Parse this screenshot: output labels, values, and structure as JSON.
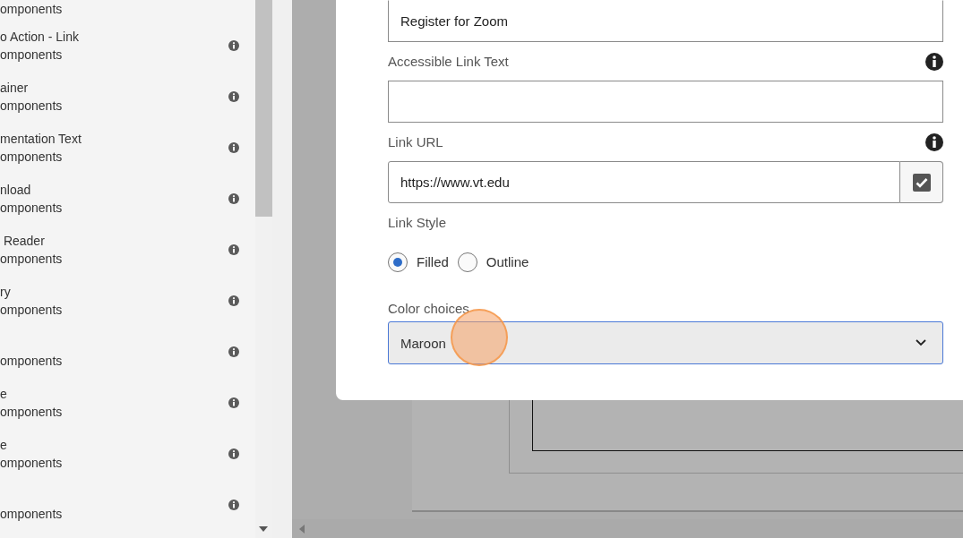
{
  "sidebar": {
    "items": [
      {
        "subtitle": "omponents"
      },
      {
        "title": "o Action - Link",
        "subtitle": "omponents"
      },
      {
        "title": "ainer",
        "subtitle": "omponents"
      },
      {
        "title": "mentation Text",
        "subtitle": "omponents"
      },
      {
        "title": "nload",
        "subtitle": "omponents"
      },
      {
        "title": " Reader",
        "subtitle": "omponents"
      },
      {
        "title": "ry",
        "subtitle": "omponents"
      },
      {
        "subtitle": "omponents"
      },
      {
        "title": "e",
        "subtitle": "omponents"
      },
      {
        "title": "e",
        "subtitle": "omponents"
      },
      {
        "subtitle": "omponents"
      }
    ]
  },
  "dialog": {
    "text_field": {
      "value": "Register for Zoom"
    },
    "accessible_link_text": {
      "label": "Accessible Link Text"
    },
    "link_url": {
      "label": "Link URL",
      "value": "https://www.vt.edu",
      "checked": true
    },
    "link_style": {
      "label": "Link Style",
      "options": [
        {
          "label": "Filled",
          "selected": true
        },
        {
          "label": "Outline",
          "selected": false
        }
      ]
    },
    "color_choices": {
      "label": "Color choices",
      "value": "Maroon"
    }
  }
}
